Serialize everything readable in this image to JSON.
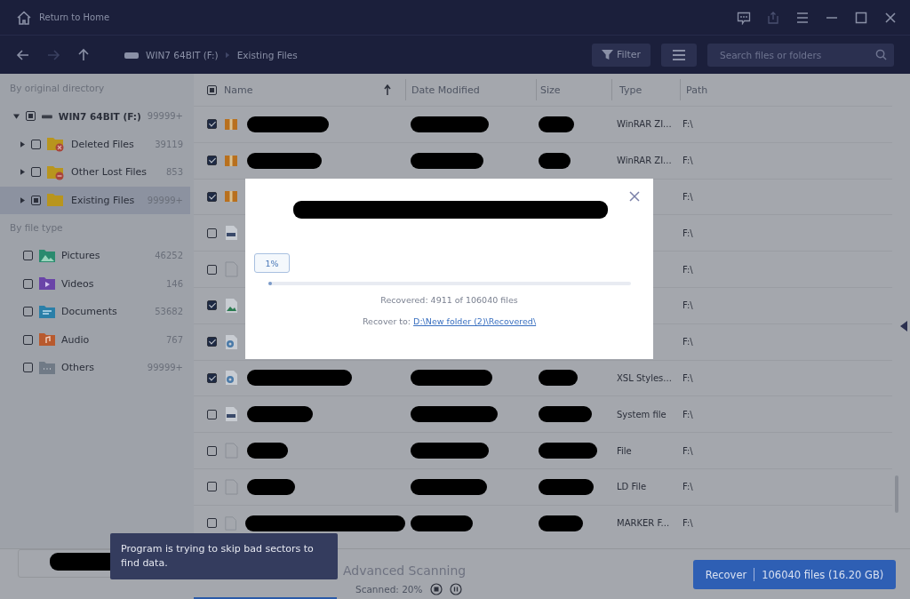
{
  "title_bar": {
    "home_label": "Return to Home"
  },
  "toolbar": {
    "breadcrumb": [
      "WIN7 64BIT (F:)",
      "Existing Files"
    ],
    "filter_label": "Filter",
    "search": {
      "placeholder": "Search files or folders"
    }
  },
  "sidebar": {
    "directory_heading": "By original directory",
    "drive": {
      "label": "WIN7 64BIT (F:)",
      "count": "99999+",
      "mixed": true,
      "expanded": true,
      "children": [
        {
          "label": "Deleted Files",
          "count": "39119",
          "checked": false,
          "mixed": false,
          "selected": false,
          "kind": "deleted"
        },
        {
          "label": "Other Lost Files",
          "count": "853",
          "checked": false,
          "mixed": false,
          "selected": false,
          "kind": "lost"
        },
        {
          "label": "Existing Files",
          "count": "99999+",
          "mixed": true,
          "selected": true,
          "kind": "plain"
        }
      ]
    },
    "type_heading": "By file type",
    "types": [
      {
        "label": "Pictures",
        "count": "46252",
        "checked": false,
        "kind": "pictures"
      },
      {
        "label": "Videos",
        "count": "146",
        "checked": false,
        "kind": "videos"
      },
      {
        "label": "Documents",
        "count": "53682",
        "checked": false,
        "kind": "documents"
      },
      {
        "label": "Audio",
        "count": "767",
        "checked": false,
        "kind": "audio"
      },
      {
        "label": "Others",
        "count": "99999+",
        "checked": false,
        "kind": "others"
      }
    ]
  },
  "table": {
    "columns": [
      "Name",
      "Date Modified",
      "Size",
      "Type",
      "Path"
    ],
    "header_mixed": true,
    "rows": [
      {
        "checked": true,
        "kind": "archive",
        "type": "WinRAR ZI...",
        "path": "F:\\"
      },
      {
        "checked": true,
        "kind": "archive",
        "type": "WinRAR ZI...",
        "path": "F:\\"
      },
      {
        "checked": true,
        "kind": "archive",
        "path": "F:\\"
      },
      {
        "checked": false,
        "kind": "system",
        "path": "F:\\"
      },
      {
        "checked": false,
        "kind": "blank",
        "path": "F:\\"
      },
      {
        "checked": true,
        "kind": "image",
        "path": "F:\\"
      },
      {
        "checked": true,
        "kind": "settings",
        "path": "F:\\"
      },
      {
        "checked": true,
        "kind": "settings",
        "type": "XSL Styles...",
        "path": "F:\\"
      },
      {
        "checked": false,
        "kind": "system",
        "type": "System file",
        "path": "F:\\"
      },
      {
        "checked": false,
        "kind": "blank",
        "type": "File",
        "path": "F:\\"
      },
      {
        "checked": false,
        "kind": "blank",
        "type": "LD File",
        "path": "F:\\"
      },
      {
        "checked": false,
        "kind": "blank",
        "type": "MARKER F...",
        "path": "F:\\"
      }
    ]
  },
  "dialog": {
    "percent": "1%",
    "level": 0.01,
    "recovered": "Recovered: 4911 of 106040 files",
    "recover_to_label": "Recover to:",
    "recover_to_path": "D:\\New folder (2)\\Recovered\\"
  },
  "bottom_bar": {
    "scan_title": "Advanced Scanning",
    "scanned": "Scanned: 20%",
    "level": 0.2,
    "tooltip": "Program is trying to skip bad sectors to find data.",
    "recover_button": "Recover",
    "recover_summary": "106040 files (16.20 GB)"
  }
}
